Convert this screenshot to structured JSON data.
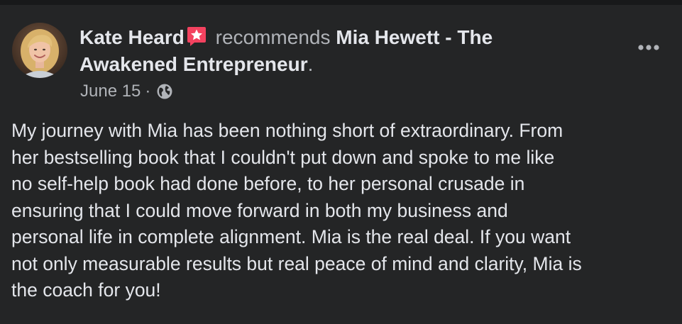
{
  "post": {
    "author": "Kate Heard",
    "verb": "recommends",
    "page": "Mia Hewett - The Awakened Entrepreneur",
    "period": ".",
    "date": "June 15",
    "date_separator": "·",
    "privacy_icon": "globe-icon",
    "more_icon": "ellipsis-icon",
    "recommend_icon": "star-badge-icon",
    "body": "My journey with Mia has been nothing short of extraordinary. From\nher bestselling book that I couldn't put down and spoke to me like\nno self-help book had done before, to her personal crusade in\nensuring that I could move forward in both my business and\npersonal life in complete alignment. Mia is the real deal. If you want\nnot only measurable results but real peace of mind and clarity, Mia is\nthe coach for you!"
  },
  "colors": {
    "background": "#242526",
    "top_strip": "#18191a",
    "primary_text": "#e4e6eb",
    "secondary_text": "#b0b3b8",
    "recommend_badge": "#f3425f"
  }
}
